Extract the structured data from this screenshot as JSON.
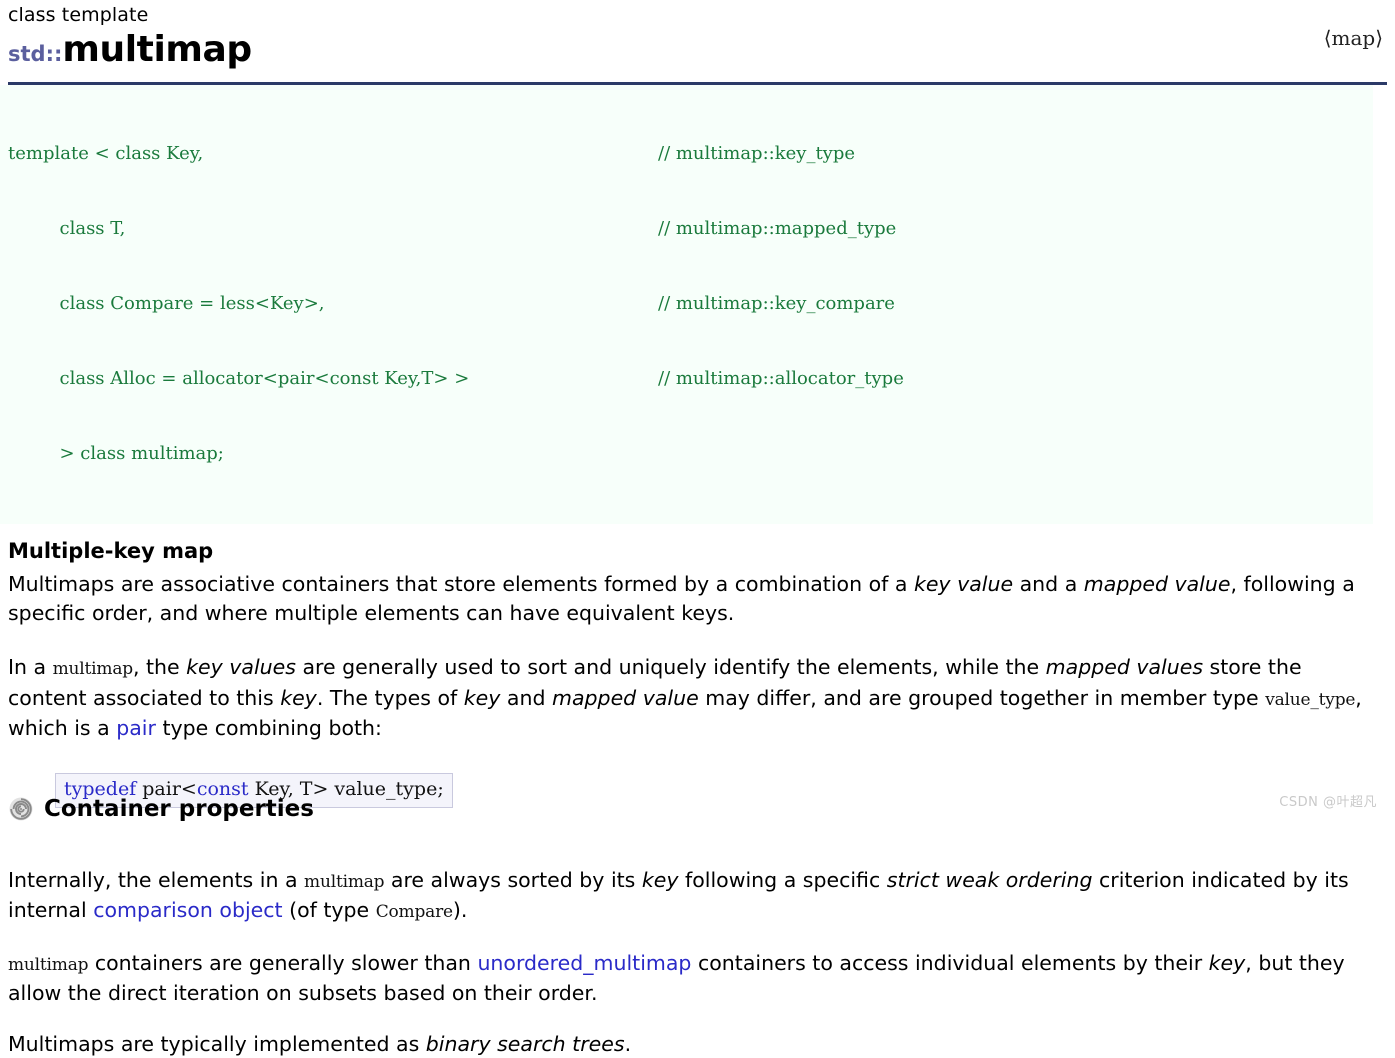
{
  "header": {
    "kicker": "class template",
    "namespace": "std::",
    "title": "multimap",
    "header_file": "⟨map⟩",
    "rule_color": "#2b3a67",
    "namespace_color": "#5b5f9e"
  },
  "template_block": {
    "background": "#f7fffa",
    "text_color": "#1a7a3c",
    "lines": [
      {
        "code": "template < class Key,",
        "comment": "// multimap::key_type"
      },
      {
        "code": "         class T,",
        "comment": "// multimap::mapped_type"
      },
      {
        "code": "         class Compare = less<Key>,",
        "comment": "// multimap::key_compare"
      },
      {
        "code": "         class Alloc = allocator<pair<const Key,T> >",
        "comment": "// multimap::allocator_type"
      },
      {
        "code": "         > class multimap;",
        "comment": ""
      }
    ]
  },
  "sections": {
    "multiple_key_map_heading": "Multiple-key map",
    "container_properties_heading": "Container properties"
  },
  "paragraphs": {
    "p1_a": "Multimaps are associative containers that store elements formed by a combination of a ",
    "p1_em1": "key value",
    "p1_b": " and a ",
    "p1_em2": "mapped value",
    "p1_c": ", following a specific order, and where multiple elements can have equivalent keys.",
    "p2_a": "In a ",
    "p2_code1": "multimap",
    "p2_b": ", the ",
    "p2_em1": "key values",
    "p2_c": " are generally used to sort and uniquely identify the elements, while the ",
    "p2_em2": "mapped values",
    "p2_d": " store the content associated to this ",
    "p2_em3": "key",
    "p2_e": ". The types of ",
    "p2_em4": "key",
    "p2_f": " and ",
    "p2_em5": "mapped value",
    "p2_g": " may differ, and are grouped together in member type ",
    "p2_code2": "value_type",
    "p2_h": ", which is a ",
    "p2_link": "pair",
    "p2_i": " type combining both:",
    "p3_a": "Internally, the elements in a ",
    "p3_code1": "multimap",
    "p3_b": " are always sorted by its ",
    "p3_em1": "key",
    "p3_c": " following a specific ",
    "p3_em2": "strict weak ordering",
    "p3_d": " criterion indicated by its internal ",
    "p3_link": "comparison object",
    "p3_e": " (of type ",
    "p3_code2": "Compare",
    "p3_f": ").",
    "p4_code1": "multimap",
    "p4_a": " containers are generally slower than ",
    "p4_link": "unordered_multimap",
    "p4_b": " containers to access individual elements by their ",
    "p4_em1": "key",
    "p4_c": ", but they allow the direct iteration on subsets based on their order.",
    "p5_a": "Multimaps are typically implemented as ",
    "p5_em1": "binary search trees",
    "p5_b": "."
  },
  "typedef_box": {
    "kw1": "typedef",
    "mid1": " pair<",
    "kw2": "const",
    "mid2": " Key, T> value_type;",
    "background": "#f4f4fb",
    "border_color": "#c9c9de",
    "keyword_color": "#2a2ac8"
  },
  "watermark": {
    "text": "CSDN @叶超凡",
    "color": "#c9c9c9"
  },
  "icons": {
    "spiral": "spiral-icon"
  }
}
